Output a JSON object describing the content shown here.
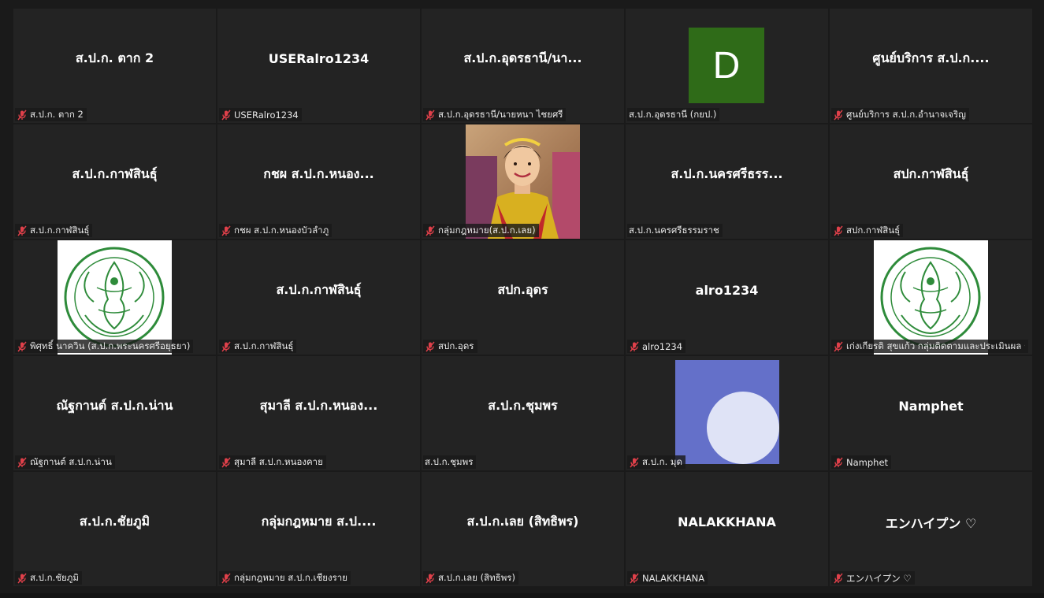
{
  "window": {
    "title": "Gallery View"
  },
  "colors": {
    "tile_bg": "#232323",
    "mute_icon": "#e0404a",
    "avatar_green": "#2f6b18",
    "avatar_purple": "#6470c9",
    "seal_green": "#2e8b3a"
  },
  "tiles": [
    {
      "display": "ส.ป.ก. ตาก 2",
      "caption": "ส.ป.ก. ตาก 2",
      "muted": true,
      "media": "name"
    },
    {
      "display": "USERalro1234",
      "caption": "USERalro1234",
      "muted": true,
      "media": "name"
    },
    {
      "display": "ส.ป.ก.อุดรธานี/นา...",
      "caption": "ส.ป.ก.อุดรธานี/นายหนา ไชยศรี",
      "muted": true,
      "media": "name"
    },
    {
      "display": "D",
      "caption": "ส.ป.ก.อุดรธานี (กยป.)",
      "muted": false,
      "media": "letter-avatar"
    },
    {
      "display": "ศูนย์บริการ ส.ป.ก....",
      "caption": "ศูนย์บริการ ส.ป.ก.อำนาจเจริญ",
      "muted": true,
      "media": "name"
    },
    {
      "display": "ส.ป.ก.กาฬสินธุ์",
      "caption": "ส.ป.ก.กาฬสินธุ์",
      "muted": true,
      "media": "name"
    },
    {
      "display": "กชผ ส.ป.ก.หนอง...",
      "caption": "กชผ ส.ป.ก.หนองบัวลำภู",
      "muted": true,
      "media": "name"
    },
    {
      "display": "",
      "caption": "กลุ่มกฎหมาย(ส.ป.ก.เลย)",
      "muted": true,
      "media": "photo-person"
    },
    {
      "display": "ส.ป.ก.นครศรีธรร...",
      "caption": "ส.ป.ก.นครศรีธรรมราช",
      "muted": false,
      "media": "name"
    },
    {
      "display": "สปก.กาฬสินธุ์",
      "caption": "สปก.กาฬสินธุ์",
      "muted": true,
      "media": "name"
    },
    {
      "display": "",
      "caption": "พิศุทธิ์ นาควิน (ส.ป.ก.พระนครศรีอยุธยา)",
      "muted": true,
      "media": "seal"
    },
    {
      "display": "ส.ป.ก.กาฬสินธุ์",
      "caption": "ส.ป.ก.กาฬสินธุ์",
      "muted": true,
      "media": "name"
    },
    {
      "display": "สปก.อุดร",
      "caption": "สปก.อุดร",
      "muted": true,
      "media": "name"
    },
    {
      "display": "alro1234",
      "caption": "alro1234",
      "muted": true,
      "media": "name"
    },
    {
      "display": "",
      "caption": "เก่งเกียรติ สุขแก้ว กลุ่มติดตามและประเมินผล ก...",
      "muted": true,
      "media": "seal"
    },
    {
      "display": "ณัฐกานต์ ส.ป.ก.น่าน",
      "caption": "ณัฐกานต์ ส.ป.ก.น่าน",
      "muted": true,
      "media": "name"
    },
    {
      "display": "สุมาลี ส.ป.ก.หนอง...",
      "caption": "สุมาลี ส.ป.ก.หนองคาย",
      "muted": true,
      "media": "name"
    },
    {
      "display": "ส.ป.ก.ชุมพร",
      "caption": "ส.ป.ก.ชุมพร",
      "muted": false,
      "media": "name"
    },
    {
      "display": "",
      "caption": "ส.ป.ก. มุด",
      "muted": true,
      "media": "circle-avatar"
    },
    {
      "display": "Namphet",
      "caption": "Namphet",
      "muted": true,
      "media": "name"
    },
    {
      "display": "ส.ป.ก.ชัยภูมิ",
      "caption": "ส.ป.ก.ชัยภูมิ",
      "muted": true,
      "media": "name"
    },
    {
      "display": "กลุ่มกฎหมาย ส.ป....",
      "caption": "กลุ่มกฎหมาย ส.ป.ก.เชียงราย",
      "muted": true,
      "media": "name"
    },
    {
      "display": "ส.ป.ก.เลย (สิทธิพร)",
      "caption": "ส.ป.ก.เลย (สิทธิพร)",
      "muted": true,
      "media": "name"
    },
    {
      "display": "NALAKKHANA",
      "caption": "NALAKKHANA",
      "muted": true,
      "media": "name"
    },
    {
      "display": "エンハイプン ♡",
      "caption": "エンハイプン ♡",
      "muted": true,
      "media": "name"
    }
  ]
}
